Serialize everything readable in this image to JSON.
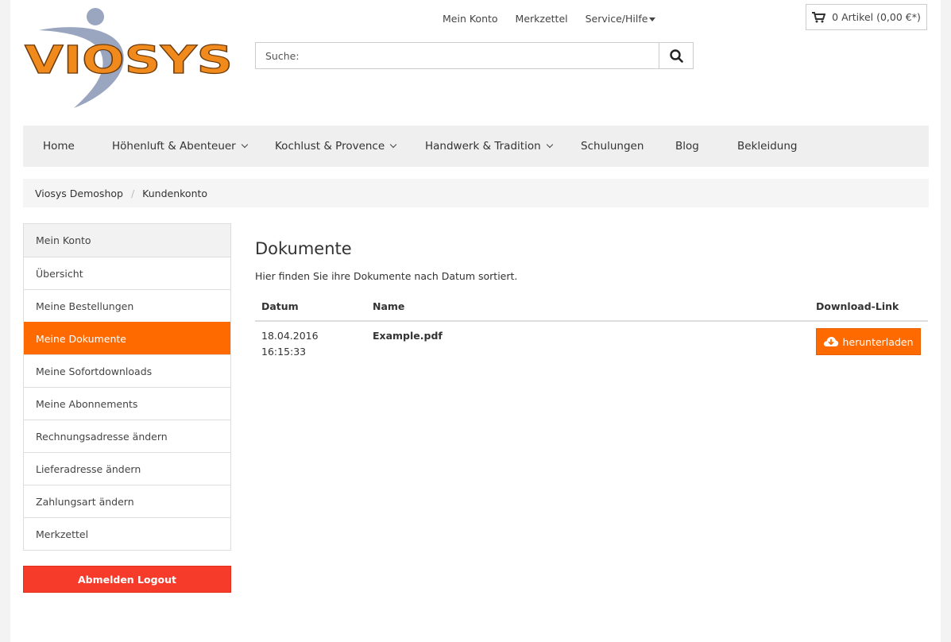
{
  "logo": {
    "text": "VIOSYS"
  },
  "top_links": {
    "account": "Mein Konto",
    "wishlist": "Merkzettel",
    "service": "Service/Hilfe"
  },
  "cart": {
    "label": "0 Artikel (0,00 €*)"
  },
  "search": {
    "placeholder": "Suche:"
  },
  "nav": {
    "items": [
      {
        "label": "Home"
      },
      {
        "label": "Höhenluft & Abenteuer"
      },
      {
        "label": "Kochlust & Provence"
      },
      {
        "label": "Handwerk & Tradition"
      },
      {
        "label": "Schulungen"
      },
      {
        "label": "Blog"
      },
      {
        "label": "Bekleidung"
      }
    ]
  },
  "breadcrumb": {
    "items": [
      "Viosys Demoshop",
      "Kundenkonto"
    ],
    "separator": "/"
  },
  "sidebar": {
    "heading": "Mein Konto",
    "items": [
      "Übersicht",
      "Meine Bestellungen",
      "Meine Dokumente",
      "Meine Sofortdownloads",
      "Meine Abonnements",
      "Rechnungsadresse ändern",
      "Lieferadresse ändern",
      "Zahlungsart ändern",
      "Merkzettel"
    ],
    "logout_label": "Abmelden Logout"
  },
  "main": {
    "title": "Dokumente",
    "subtitle": "Hier finden Sie ihre Dokumente nach Datum sortiert.",
    "columns": [
      "Datum",
      "Name",
      "Download-Link"
    ],
    "rows": [
      {
        "date": "18.04.2016",
        "time": "16:15:33",
        "name": "Example.pdf",
        "button": "herunterladen"
      }
    ]
  },
  "colors": {
    "accent": "#ff6a00",
    "logout": "#f73b2a",
    "logo_gray": "#9aa6c0"
  }
}
